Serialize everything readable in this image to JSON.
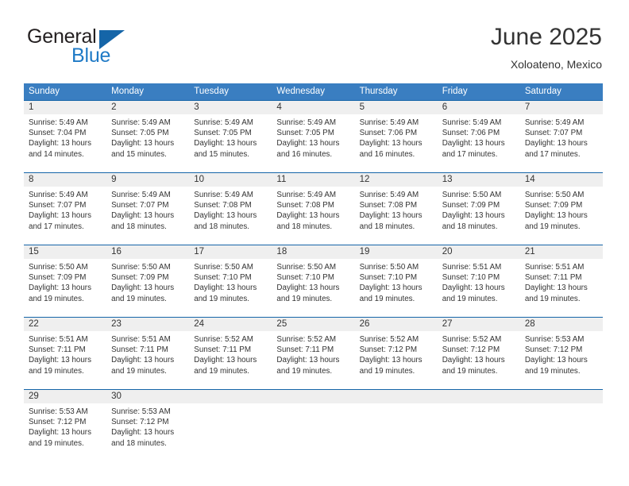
{
  "brand": {
    "name_top": "General",
    "name_bottom": "Blue",
    "accent_color": "#1565a8",
    "blue_text_color": "#1f7ac6"
  },
  "header": {
    "title": "June 2025",
    "location": "Xoloateno, Mexico"
  },
  "calendar": {
    "header_bg": "#3a7ec1",
    "separator_color": "#1565a8",
    "daynum_bg": "#efefef",
    "weekday_headers": [
      "Sunday",
      "Monday",
      "Tuesday",
      "Wednesday",
      "Thursday",
      "Friday",
      "Saturday"
    ],
    "weeks": [
      [
        {
          "day": "1",
          "sunrise": "Sunrise: 5:49 AM",
          "sunset": "Sunset: 7:04 PM",
          "daylight": "Daylight: 13 hours and 14 minutes."
        },
        {
          "day": "2",
          "sunrise": "Sunrise: 5:49 AM",
          "sunset": "Sunset: 7:05 PM",
          "daylight": "Daylight: 13 hours and 15 minutes."
        },
        {
          "day": "3",
          "sunrise": "Sunrise: 5:49 AM",
          "sunset": "Sunset: 7:05 PM",
          "daylight": "Daylight: 13 hours and 15 minutes."
        },
        {
          "day": "4",
          "sunrise": "Sunrise: 5:49 AM",
          "sunset": "Sunset: 7:05 PM",
          "daylight": "Daylight: 13 hours and 16 minutes."
        },
        {
          "day": "5",
          "sunrise": "Sunrise: 5:49 AM",
          "sunset": "Sunset: 7:06 PM",
          "daylight": "Daylight: 13 hours and 16 minutes."
        },
        {
          "day": "6",
          "sunrise": "Sunrise: 5:49 AM",
          "sunset": "Sunset: 7:06 PM",
          "daylight": "Daylight: 13 hours and 17 minutes."
        },
        {
          "day": "7",
          "sunrise": "Sunrise: 5:49 AM",
          "sunset": "Sunset: 7:07 PM",
          "daylight": "Daylight: 13 hours and 17 minutes."
        }
      ],
      [
        {
          "day": "8",
          "sunrise": "Sunrise: 5:49 AM",
          "sunset": "Sunset: 7:07 PM",
          "daylight": "Daylight: 13 hours and 17 minutes."
        },
        {
          "day": "9",
          "sunrise": "Sunrise: 5:49 AM",
          "sunset": "Sunset: 7:07 PM",
          "daylight": "Daylight: 13 hours and 18 minutes."
        },
        {
          "day": "10",
          "sunrise": "Sunrise: 5:49 AM",
          "sunset": "Sunset: 7:08 PM",
          "daylight": "Daylight: 13 hours and 18 minutes."
        },
        {
          "day": "11",
          "sunrise": "Sunrise: 5:49 AM",
          "sunset": "Sunset: 7:08 PM",
          "daylight": "Daylight: 13 hours and 18 minutes."
        },
        {
          "day": "12",
          "sunrise": "Sunrise: 5:49 AM",
          "sunset": "Sunset: 7:08 PM",
          "daylight": "Daylight: 13 hours and 18 minutes."
        },
        {
          "day": "13",
          "sunrise": "Sunrise: 5:50 AM",
          "sunset": "Sunset: 7:09 PM",
          "daylight": "Daylight: 13 hours and 18 minutes."
        },
        {
          "day": "14",
          "sunrise": "Sunrise: 5:50 AM",
          "sunset": "Sunset: 7:09 PM",
          "daylight": "Daylight: 13 hours and 19 minutes."
        }
      ],
      [
        {
          "day": "15",
          "sunrise": "Sunrise: 5:50 AM",
          "sunset": "Sunset: 7:09 PM",
          "daylight": "Daylight: 13 hours and 19 minutes."
        },
        {
          "day": "16",
          "sunrise": "Sunrise: 5:50 AM",
          "sunset": "Sunset: 7:09 PM",
          "daylight": "Daylight: 13 hours and 19 minutes."
        },
        {
          "day": "17",
          "sunrise": "Sunrise: 5:50 AM",
          "sunset": "Sunset: 7:10 PM",
          "daylight": "Daylight: 13 hours and 19 minutes."
        },
        {
          "day": "18",
          "sunrise": "Sunrise: 5:50 AM",
          "sunset": "Sunset: 7:10 PM",
          "daylight": "Daylight: 13 hours and 19 minutes."
        },
        {
          "day": "19",
          "sunrise": "Sunrise: 5:50 AM",
          "sunset": "Sunset: 7:10 PM",
          "daylight": "Daylight: 13 hours and 19 minutes."
        },
        {
          "day": "20",
          "sunrise": "Sunrise: 5:51 AM",
          "sunset": "Sunset: 7:10 PM",
          "daylight": "Daylight: 13 hours and 19 minutes."
        },
        {
          "day": "21",
          "sunrise": "Sunrise: 5:51 AM",
          "sunset": "Sunset: 7:11 PM",
          "daylight": "Daylight: 13 hours and 19 minutes."
        }
      ],
      [
        {
          "day": "22",
          "sunrise": "Sunrise: 5:51 AM",
          "sunset": "Sunset: 7:11 PM",
          "daylight": "Daylight: 13 hours and 19 minutes."
        },
        {
          "day": "23",
          "sunrise": "Sunrise: 5:51 AM",
          "sunset": "Sunset: 7:11 PM",
          "daylight": "Daylight: 13 hours and 19 minutes."
        },
        {
          "day": "24",
          "sunrise": "Sunrise: 5:52 AM",
          "sunset": "Sunset: 7:11 PM",
          "daylight": "Daylight: 13 hours and 19 minutes."
        },
        {
          "day": "25",
          "sunrise": "Sunrise: 5:52 AM",
          "sunset": "Sunset: 7:11 PM",
          "daylight": "Daylight: 13 hours and 19 minutes."
        },
        {
          "day": "26",
          "sunrise": "Sunrise: 5:52 AM",
          "sunset": "Sunset: 7:12 PM",
          "daylight": "Daylight: 13 hours and 19 minutes."
        },
        {
          "day": "27",
          "sunrise": "Sunrise: 5:52 AM",
          "sunset": "Sunset: 7:12 PM",
          "daylight": "Daylight: 13 hours and 19 minutes."
        },
        {
          "day": "28",
          "sunrise": "Sunrise: 5:53 AM",
          "sunset": "Sunset: 7:12 PM",
          "daylight": "Daylight: 13 hours and 19 minutes."
        }
      ],
      [
        {
          "day": "29",
          "sunrise": "Sunrise: 5:53 AM",
          "sunset": "Sunset: 7:12 PM",
          "daylight": "Daylight: 13 hours and 19 minutes."
        },
        {
          "day": "30",
          "sunrise": "Sunrise: 5:53 AM",
          "sunset": "Sunset: 7:12 PM",
          "daylight": "Daylight: 13 hours and 18 minutes."
        },
        {
          "day": "",
          "sunrise": "",
          "sunset": "",
          "daylight": ""
        },
        {
          "day": "",
          "sunrise": "",
          "sunset": "",
          "daylight": ""
        },
        {
          "day": "",
          "sunrise": "",
          "sunset": "",
          "daylight": ""
        },
        {
          "day": "",
          "sunrise": "",
          "sunset": "",
          "daylight": ""
        },
        {
          "day": "",
          "sunrise": "",
          "sunset": "",
          "daylight": ""
        }
      ]
    ]
  }
}
